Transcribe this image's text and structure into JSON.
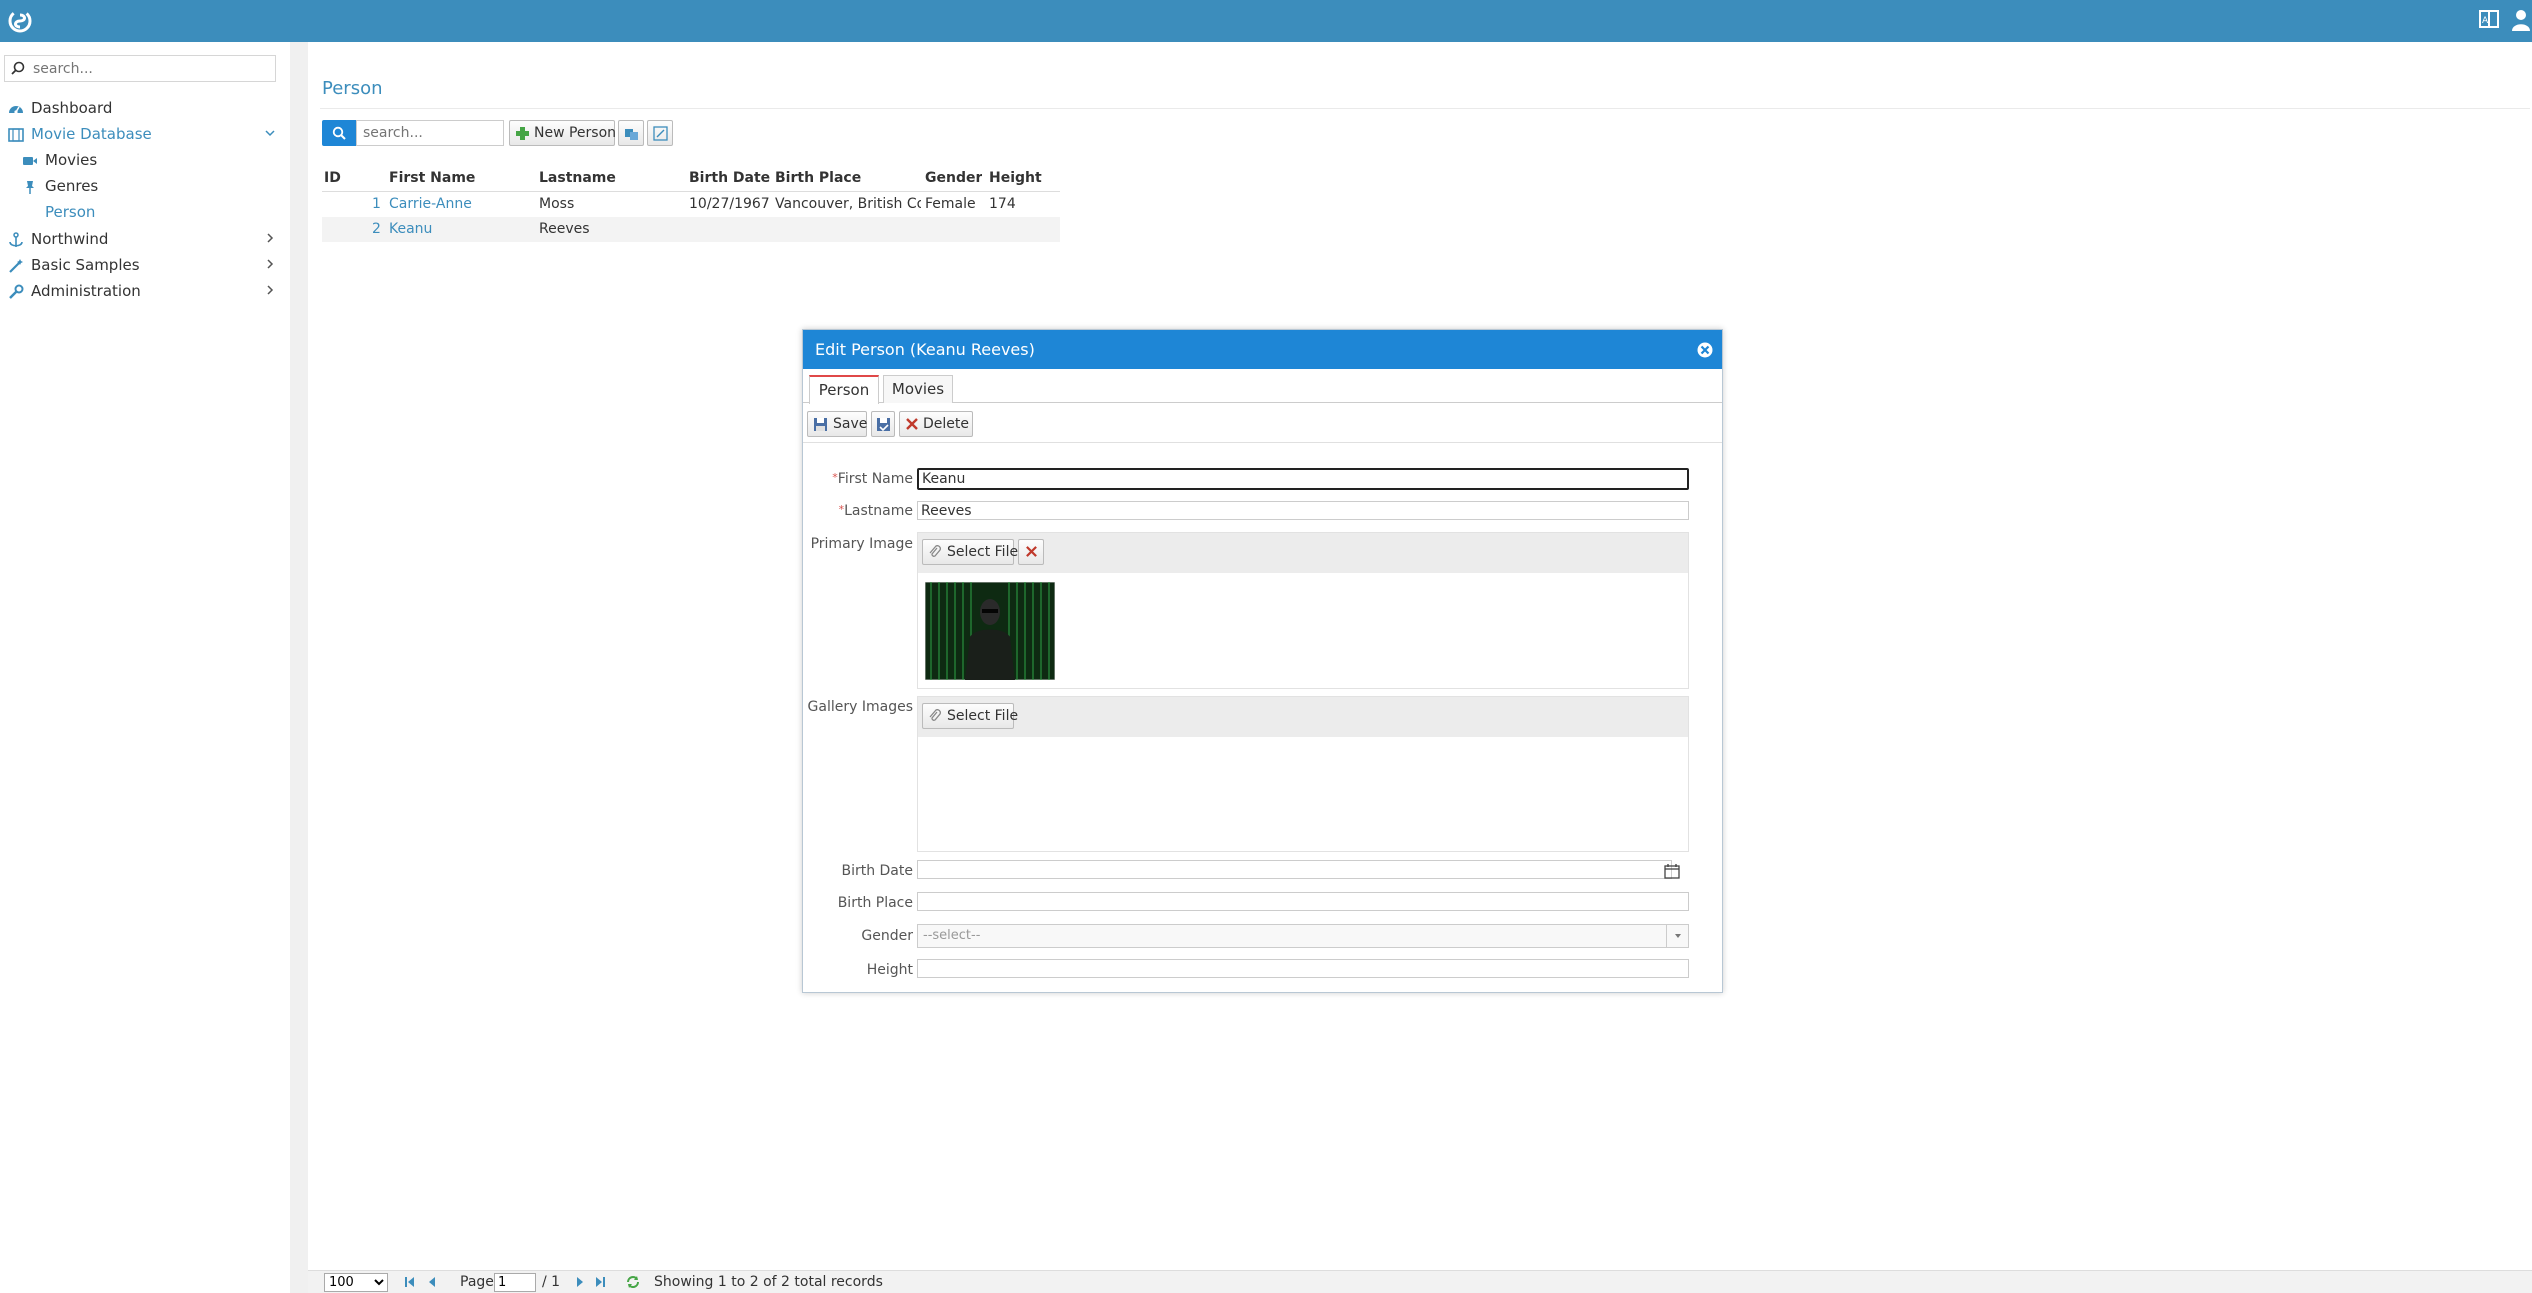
{
  "topbar": {
    "logo_icon": "serenity-logo-icon",
    "translate_icon": "translate-icon",
    "user_icon": "user-icon"
  },
  "sidebar": {
    "search_placeholder": "search...",
    "items": [
      {
        "label": "Dashboard",
        "icon": "dashboard-icon"
      },
      {
        "label": "Movie Database",
        "icon": "film-icon"
      },
      {
        "label": "Movies",
        "icon": "video-camera-icon"
      },
      {
        "label": "Genres",
        "icon": "pin-icon"
      },
      {
        "label": "Person",
        "icon": ""
      },
      {
        "label": "Northwind",
        "icon": "anchor-icon"
      },
      {
        "label": "Basic Samples",
        "icon": "magic-wand-icon"
      },
      {
        "label": "Administration",
        "icon": "wrench-icon"
      }
    ]
  },
  "page": {
    "title": "Person",
    "search_placeholder": "search...",
    "new_button": "New Person"
  },
  "grid": {
    "columns": [
      "ID",
      "First Name",
      "Lastname",
      "Birth Date",
      "Birth Place",
      "Gender",
      "Height"
    ],
    "rows": [
      {
        "id": "1",
        "first": "Carrie-Anne",
        "last": "Moss",
        "birth_date": "10/27/1967",
        "birth_place": "Vancouver, British Col...",
        "gender": "Female",
        "height": "174"
      },
      {
        "id": "2",
        "first": "Keanu",
        "last": "Reeves",
        "birth_date": "",
        "birth_place": "",
        "gender": "",
        "height": ""
      }
    ]
  },
  "pager": {
    "page_size": "100",
    "page_label": "Page",
    "page_value": "1",
    "total_pages": "/ 1",
    "status": "Showing 1 to 2 of 2 total records"
  },
  "dialog": {
    "title": "Edit Person (Keanu Reeves)",
    "tabs": [
      "Person",
      "Movies"
    ],
    "save": "Save",
    "delete": "Delete",
    "labels": {
      "first_name": "First Name",
      "lastname": "Lastname",
      "primary_image": "Primary Image",
      "gallery_images": "Gallery Images",
      "birth_date": "Birth Date",
      "birth_place": "Birth Place",
      "gender": "Gender",
      "height": "Height"
    },
    "values": {
      "first_name": "Keanu",
      "lastname": "Reeves",
      "birth_date": "",
      "birth_place": "",
      "height": ""
    },
    "select_file": "Select File",
    "gender_placeholder": "--select--"
  },
  "colors": {
    "header": "#3c8dbc",
    "dialog_header": "#1e86d6",
    "link": "#3c8dbc"
  }
}
